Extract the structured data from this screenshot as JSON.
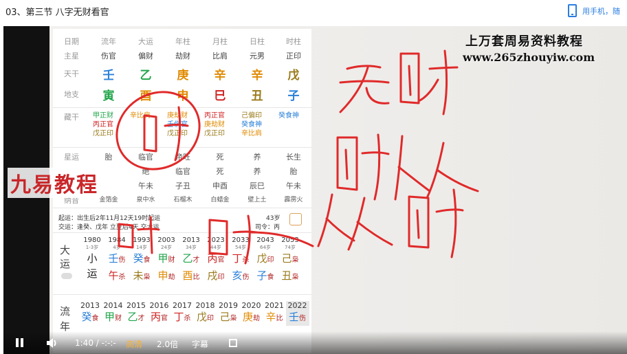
{
  "title": "03、第三节 八字无财看官",
  "mobile_label": "用手机，随",
  "watermark_line1": "上万套周易资料教程",
  "watermark_line2": "www.265zhouyiw.com",
  "logo": "九易教程",
  "pillars": {
    "row_labels": [
      "日期",
      "主星",
      "天干",
      "地支"
    ],
    "headers": [
      "流年",
      "大运",
      "年柱",
      "月柱",
      "日柱",
      "时柱"
    ],
    "main_star": [
      "伤官",
      "偏财",
      "劫财",
      "比肩",
      "元男",
      "正印"
    ],
    "gan": [
      "壬",
      "乙",
      "庚",
      "辛",
      "辛",
      "戊"
    ],
    "zhi": [
      "寅",
      "酉",
      "申",
      "巳",
      "丑",
      "子"
    ]
  },
  "canggan": {
    "label": "藏干",
    "cols": [
      [
        "甲正财",
        "丙正官",
        "戊正印"
      ],
      [
        "辛比肩"
      ],
      [
        "庚劫财",
        "壬伤官",
        "戊正印"
      ],
      [
        "丙正官",
        "庚劫财",
        "戊正印"
      ],
      [
        "己偏印",
        "癸食神",
        "辛比肩"
      ],
      [
        "癸食神"
      ]
    ]
  },
  "xingyun": {
    "label": "星运",
    "vals": [
      "胎",
      "临官",
      "帝旺",
      "死",
      "养",
      "长生"
    ]
  },
  "zizuo": {
    "vals": [
      "",
      "绝",
      "临官",
      "死",
      "养",
      "胎"
    ]
  },
  "kongwang": {
    "vals": [
      "",
      "午未",
      "子丑",
      "申酉",
      "辰巳",
      "午未"
    ]
  },
  "nayin": {
    "label": "纳音",
    "vals": [
      "金箔金",
      "泉中水",
      "石榴木",
      "白蜡金",
      "壁上土",
      "霹雳火"
    ]
  },
  "qiyun": "起运：出生后2年11月12天19时起运",
  "jiaoyun": "交运：逢癸、戊年 立夏后4天 交大运",
  "age_note": "43岁",
  "siling": "司令：丙",
  "dayun": {
    "label1": "大",
    "label2": "运",
    "label3": "小",
    "label4": "运",
    "years": [
      "1980",
      "1984",
      "1993",
      "2003",
      "2013",
      "2023",
      "2033",
      "2043",
      "2053"
    ],
    "ages": [
      "1-3岁",
      "4岁",
      "14岁",
      "24岁",
      "34岁",
      "44岁",
      "54岁",
      "64岁",
      "74岁"
    ],
    "gan": [
      "",
      "壬",
      "癸",
      "甲",
      "乙",
      "丙",
      "丁",
      "戊",
      "己"
    ],
    "zhi": [
      "",
      "午",
      "未",
      "申",
      "酉",
      "戌",
      "亥",
      "子",
      "丑"
    ],
    "gan_ss": [
      "",
      "伤",
      "食",
      "财",
      "才",
      "官",
      "杀",
      "印",
      "枭"
    ],
    "zhi_ss": [
      "",
      "杀",
      "枭",
      "劫",
      "比",
      "印",
      "伤",
      "食",
      "枭"
    ]
  },
  "liunian": {
    "label1": "流",
    "label2": "年",
    "years": [
      "2013",
      "2014",
      "2015",
      "2016",
      "2017",
      "2018",
      "2019",
      "2020",
      "2021",
      "2022"
    ],
    "gan": [
      "癸",
      "甲",
      "乙",
      "丙",
      "丁",
      "戊",
      "己",
      "庚",
      "辛",
      "壬"
    ],
    "gan_ss": [
      "食",
      "财",
      "才",
      "官",
      "杀",
      "印",
      "枭",
      "劫",
      "比",
      "伤"
    ]
  },
  "handwriting": [
    "无财",
    "财人人",
    "人人财",
    "财",
    "时",
    "财"
  ],
  "controls": {
    "time": "1:40 / -:-:-",
    "quality": "高清",
    "speed": "2.0倍",
    "subtitle": "字幕"
  }
}
